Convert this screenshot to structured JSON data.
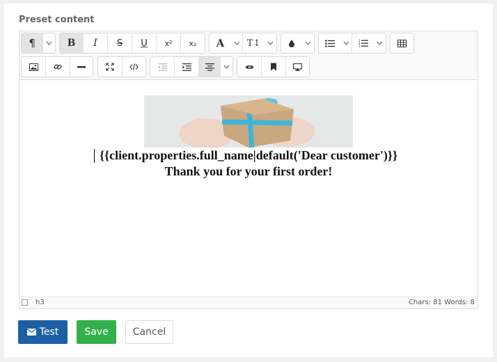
{
  "form": {
    "section_label": "Preset content"
  },
  "toolbar": {
    "paragraph_icon": "¶",
    "superscript_label": "x²",
    "subscript_label": "x₂",
    "font_label": "A",
    "size_label": "T↕"
  },
  "editor": {
    "line1": "{{client.properties.full_name|default('Dear customer')}}",
    "line2": "Thank you for your first order!",
    "image_icon": "gift-photo"
  },
  "statusbar": {
    "element_path": "h3",
    "counts": "Chars: 81   Words: 8"
  },
  "actions": {
    "test_label": "Test",
    "save_label": "Save",
    "cancel_label": "Cancel"
  },
  "colors": {
    "test_button": "#1c5fa3",
    "save_button": "#33b04b"
  }
}
